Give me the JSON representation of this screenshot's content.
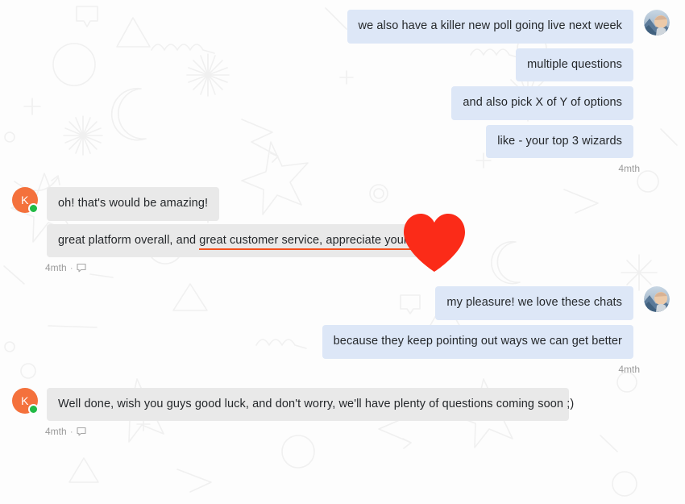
{
  "theme": {
    "outgoing_bubble_color": "#dde7f7",
    "incoming_bubble_color": "#e9e9e9",
    "text_color": "#25282b",
    "meta_text_color": "#9a9a9a",
    "avatar_letter_bg": "#f4713c",
    "status_online_color": "#21ba45",
    "annotation_underline_color": "#f4511e",
    "reaction_heart_color": "#fb2b18",
    "page_background": "#fdfdfd"
  },
  "conversation": {
    "groups": [
      {
        "id": "group-agent-poll",
        "side": "out",
        "avatar": {
          "type": "photo",
          "name": "agent-avatar"
        },
        "messages": [
          {
            "text": "we also have a killer new poll going live next week"
          },
          {
            "text": "multiple questions"
          },
          {
            "text": "and also pick X of Y of options"
          },
          {
            "text": "like - your top 3 wizards"
          }
        ],
        "meta": {
          "timestamp": "4mth",
          "icon": null
        }
      },
      {
        "id": "group-customer-praise",
        "side": "in",
        "avatar": {
          "type": "letter",
          "letter": "K",
          "name": "customer-avatar",
          "status": "online"
        },
        "messages": [
          {
            "text": "oh! that's would be amazing!"
          },
          {
            "text_before": "great platform overall, and ",
            "text_underlined": "great customer service, appreciate your help",
            "reaction": "heart"
          }
        ],
        "meta": {
          "timestamp": "4mth",
          "separator": "·",
          "icon": "comment-icon"
        }
      },
      {
        "id": "group-agent-reply",
        "side": "out",
        "avatar": {
          "type": "photo",
          "name": "agent-avatar"
        },
        "messages": [
          {
            "text": "my pleasure! we love these chats"
          },
          {
            "text": "because they keep pointing out ways we can get better"
          }
        ],
        "meta": {
          "timestamp": "4mth",
          "icon": null
        }
      },
      {
        "id": "group-customer-closing",
        "side": "in",
        "avatar": {
          "type": "letter",
          "letter": "K",
          "name": "customer-avatar",
          "status": "online"
        },
        "messages": [
          {
            "text": "Well done, wish you guys good luck, and don't worry, we'll have plenty of questions coming soon ;)"
          }
        ],
        "meta": {
          "timestamp": "4mth",
          "separator": "·",
          "icon": "comment-icon"
        }
      }
    ]
  }
}
